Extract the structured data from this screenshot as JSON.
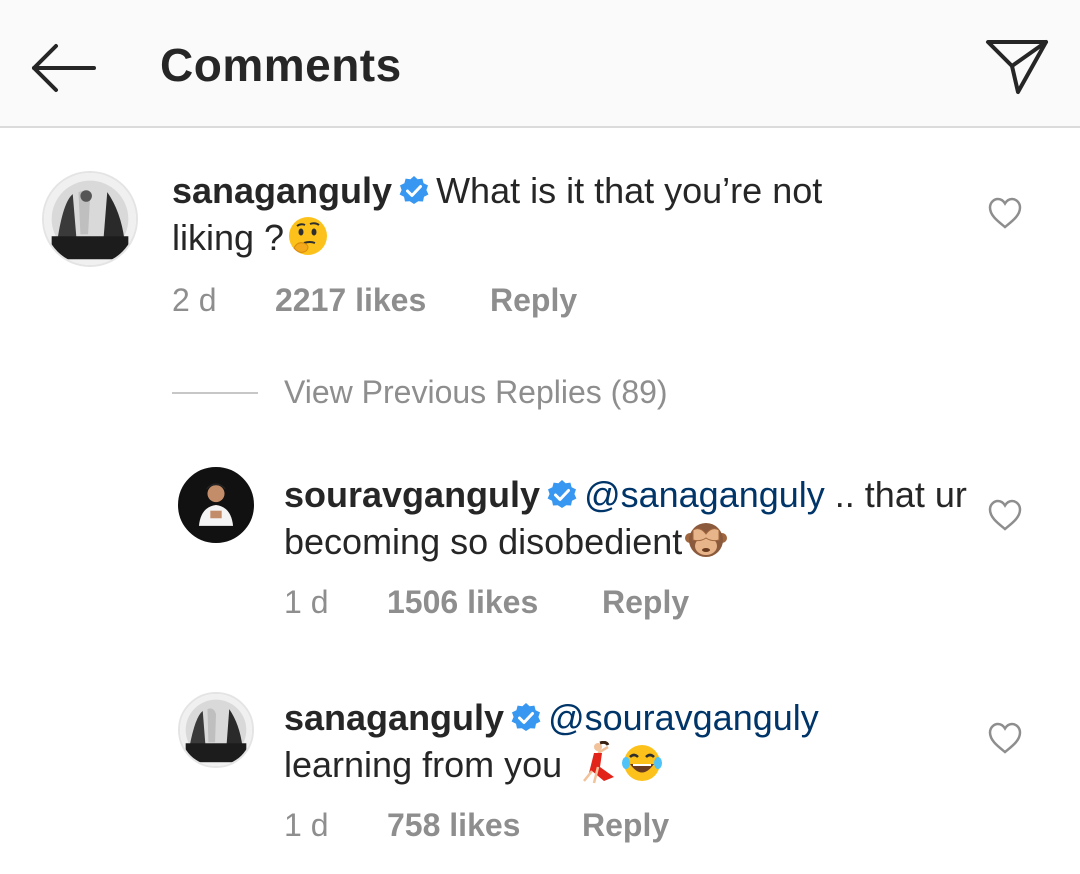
{
  "header": {
    "title": "Comments",
    "back_icon": "arrow-left-icon",
    "share_icon": "paper-plane-icon"
  },
  "colors": {
    "verified_blue": "#3897f0",
    "mention_blue": "#003569",
    "meta_gray": "#8e8e8e",
    "text_dark": "#262626",
    "header_bg": "#fafafa"
  },
  "comments": [
    {
      "username": "sanaganguly",
      "verified": true,
      "mention": "",
      "text": "What is it that you’re not liking ?",
      "emojis": [
        "thinking-face-emoji"
      ],
      "time": "2 d",
      "likes": "2217 likes",
      "reply": "Reply"
    }
  ],
  "view_previous": "View Previous Replies (89)",
  "replies": [
    {
      "username": "souravganguly",
      "verified": true,
      "mention": "@sanaganguly",
      "text": " .. that ur becoming so disobedient",
      "emojis": [
        "see-no-evil-monkey-emoji"
      ],
      "time": "1 d",
      "likes": "1506 likes",
      "reply": "Reply"
    },
    {
      "username": "sanaganguly",
      "verified": true,
      "mention": "@souravganguly",
      "text": " learning from you ",
      "emojis": [
        "dancer-emoji",
        "tears-of-joy-emoji"
      ],
      "time": "1 d",
      "likes": "758 likes",
      "reply": "Reply"
    }
  ]
}
